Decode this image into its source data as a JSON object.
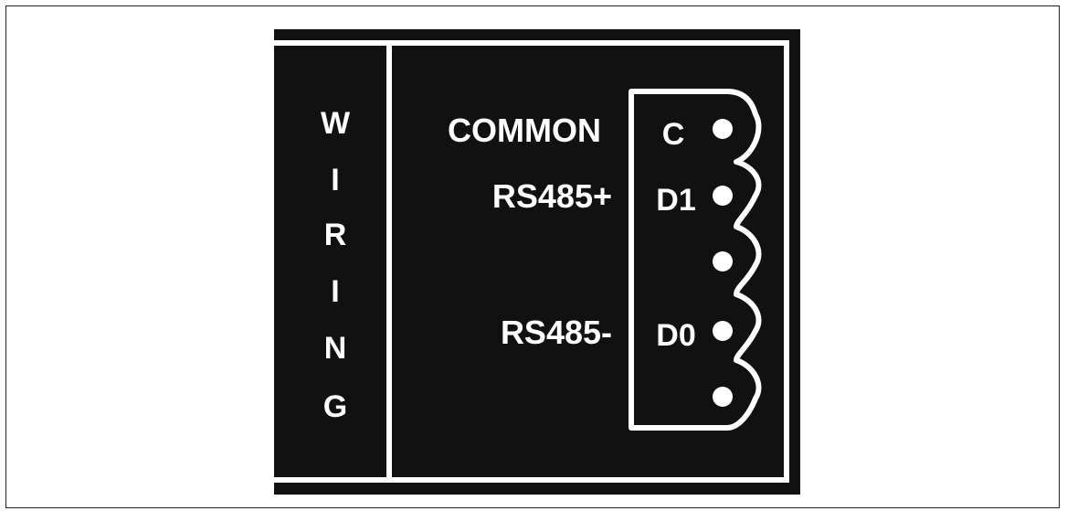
{
  "vertical_title": [
    "W",
    "I",
    "R",
    "I",
    "N",
    "G"
  ],
  "signals": [
    {
      "name": "COMMON",
      "terminal": "C"
    },
    {
      "name": "RS485+",
      "terminal": "D1"
    },
    {
      "name": "",
      "terminal": ""
    },
    {
      "name": "RS485-",
      "terminal": "D0"
    },
    {
      "name": "",
      "terminal": ""
    }
  ],
  "colors": {
    "panel": "#111111",
    "foreground": "#ffffff",
    "page_background": "#ffffff"
  }
}
